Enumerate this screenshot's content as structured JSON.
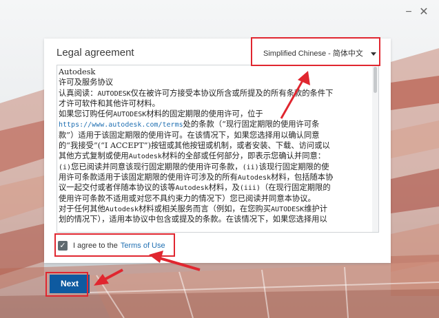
{
  "window": {
    "minimize_glyph": "−",
    "close_glyph": "✕"
  },
  "dialog": {
    "title": "Legal agreement",
    "language": {
      "selected": "Simplified Chinese - 简体中文"
    },
    "license_lines": [
      [
        {
          "t": "Autodesk"
        }
      ],
      [
        {
          "t": "许可及服务协议"
        }
      ],
      [
        {
          "t": "认真阅读："
        },
        {
          "t": "AUTODESK",
          "m": 1
        },
        {
          "t": "仅在被许可方接受本协议所含或所提及的所有条款的条件下"
        }
      ],
      [
        {
          "t": "才许可软件和其他许可材料。"
        }
      ],
      [
        {
          "t": "如果您订购任何"
        },
        {
          "t": "AUTODESK",
          "m": 1
        },
        {
          "t": "材料的固定期限的使用许可，位于"
        }
      ],
      [
        {
          "t": "https://www.autodesk.com/terms",
          "l": 1
        },
        {
          "t": "处的条款（“现行固定期限的使用许可条"
        }
      ],
      [
        {
          "t": "款”）适用于该固定期限的使用许可。在该情况下，如果您选择用以确认同意"
        }
      ],
      [
        {
          "t": "的“我接受”(“I ACCEPT”)按钮或其他按钮或机制，或者安装、下载、访问或以"
        }
      ],
      [
        {
          "t": "其他方式复制或使用"
        },
        {
          "t": "Autodesk",
          "m": 1
        },
        {
          "t": "材料的全部或任何部分，即表示您确认并同意："
        }
      ],
      [
        {
          "t": "(i)",
          "m": 1
        },
        {
          "t": "您已阅读并同意该现行固定期限的使用许可条款，"
        },
        {
          "t": "(ii)",
          "m": 1
        },
        {
          "t": "该现行固定期限的使"
        }
      ],
      [
        {
          "t": "用许可条款适用于该固定期限的使用许可涉及的所有"
        },
        {
          "t": "Autodesk",
          "m": 1
        },
        {
          "t": "材料，包括随本协"
        }
      ],
      [
        {
          "t": "议一起交付或者伴随本协议的该等"
        },
        {
          "t": "Autodesk",
          "m": 1
        },
        {
          "t": "材料，及"
        },
        {
          "t": "(iii)",
          "m": 1
        },
        {
          "t": "（在现行固定期限的"
        }
      ],
      [
        {
          "t": "使用许可条款不适用或对您不具约束力的情况下）您已阅读并同意本协议。"
        }
      ],
      [
        {
          "t": "对于任何其他"
        },
        {
          "t": "Autodesk",
          "m": 1
        },
        {
          "t": "材料或相关服务而言（例如，在您购买"
        },
        {
          "t": "AUTODESK",
          "m": 1
        },
        {
          "t": "维护计"
        }
      ],
      [
        {
          "t": "划的情况下），适用本协议中包含或提及的条款。在该情况下，如果您选择用以"
        }
      ]
    ],
    "agree": {
      "checked": true,
      "check_glyph": "✓",
      "label": "I agree to the",
      "link": "Terms of Use"
    }
  },
  "footer": {
    "next_label": "Next"
  },
  "colors": {
    "annotation_red": "#e0262f",
    "primary_button": "#0e5aa0",
    "link": "#1f6fb2"
  }
}
